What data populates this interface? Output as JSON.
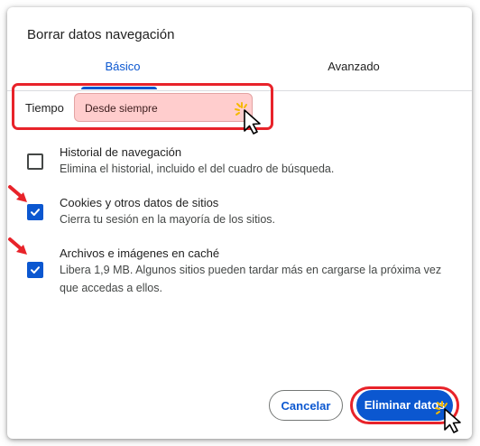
{
  "dialog": {
    "title": "Borrar datos navegación"
  },
  "tabs": [
    {
      "label": "Básico",
      "active": true
    },
    {
      "label": "Avanzado",
      "active": false
    }
  ],
  "time_range": {
    "label": "Tiempo",
    "value": "Desde siempre"
  },
  "items": [
    {
      "title": "Historial de navegación",
      "description": "Elimina el historial, incluido el del cuadro de búsqueda.",
      "checked": false
    },
    {
      "title": "Cookies y otros datos de sitios",
      "description": "Cierra tu sesión en la mayoría de los sitios.",
      "checked": true
    },
    {
      "title": "Archivos e imágenes en caché",
      "description": "Libera 1,9 MB. Algunos sitios pueden tardar más en cargarse la próxima vez que accedas a ellos.",
      "checked": true
    }
  ],
  "buttons": {
    "cancel": "Cancelar",
    "delete": "Eliminar datos"
  },
  "colors": {
    "accent": "#0b57d0",
    "highlight": "#e8232a",
    "select_fill": "#ffcdcd"
  },
  "icons": {
    "cursor": "mouse-pointer-icon",
    "arrow": "red-arrow-icon",
    "check": "checkmark-icon"
  }
}
